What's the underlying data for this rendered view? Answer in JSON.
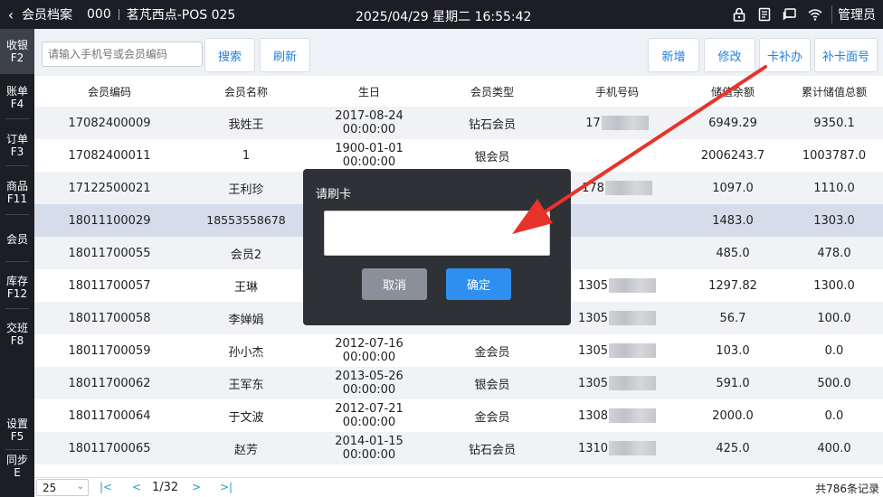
{
  "header": {
    "back_glyph": "‹",
    "title": "会员档案",
    "store_code": "000",
    "store_name": "茗芃西点-POS 025",
    "datetime": "2025/04/29 星期二 16:55:42",
    "user": "管理员",
    "icons": [
      "lock-icon",
      "note-icon",
      "chat-icon",
      "wifi-icon"
    ]
  },
  "sidebar": {
    "items": [
      {
        "label": "收银",
        "key": "F2",
        "active": true
      },
      {
        "label": "账单",
        "key": "F4"
      },
      {
        "label": "订单",
        "key": "F3"
      },
      {
        "label": "商品",
        "key": "F11"
      },
      {
        "label": "会员",
        "key": ""
      },
      {
        "label": "库存",
        "key": "F12"
      },
      {
        "label": "交班",
        "key": "F8"
      },
      {
        "label": "设置",
        "key": "F5"
      },
      {
        "label": "同步",
        "key": "E"
      }
    ]
  },
  "toolbar": {
    "search_placeholder": "请输入手机号或会员编码",
    "search_label": "搜索",
    "refresh_label": "刷新",
    "add_label": "新增",
    "edit_label": "修改",
    "card_issue_label": "卡补办",
    "card_face_label": "补卡面号"
  },
  "table": {
    "columns": [
      "会员编码",
      "会员名称",
      "生日",
      "会员类型",
      "手机号码",
      "储值余额",
      "累计储值总额"
    ],
    "rows": [
      {
        "code": "17082400009",
        "name": "我姓王",
        "birthday": "2017-08-24 00:00:00",
        "type": "钻石会员",
        "phone": "17",
        "balance": "6949.29",
        "total": "9350.1"
      },
      {
        "code": "17082400011",
        "name": "1",
        "birthday": "1900-01-01 00:00:00",
        "type": "银会员",
        "phone": "",
        "balance": "2006243.7",
        "total": "1003787.0"
      },
      {
        "code": "17122500021",
        "name": "王利珍",
        "birthday": "",
        "type": "",
        "phone": "178",
        "balance": "1097.0",
        "total": "1110.0"
      },
      {
        "code": "18011100029",
        "name": "18553558678",
        "birthday": "",
        "type": "",
        "phone": "",
        "balance": "1483.0",
        "total": "1303.0"
      },
      {
        "code": "18011700055",
        "name": "会员2",
        "birthday": "",
        "type": "",
        "phone": "",
        "balance": "485.0",
        "total": "478.0"
      },
      {
        "code": "18011700057",
        "name": "王琳",
        "birthday": "",
        "type": "",
        "phone": "1305",
        "balance": "1297.82",
        "total": "1300.0"
      },
      {
        "code": "18011700058",
        "name": "李婵娟",
        "birthday": "",
        "type": "",
        "phone": "1305",
        "balance": "56.7",
        "total": "100.0"
      },
      {
        "code": "18011700059",
        "name": "孙小杰",
        "birthday": "2012-07-16 00:00:00",
        "type": "金会员",
        "phone": "1305",
        "balance": "103.0",
        "total": "0.0"
      },
      {
        "code": "18011700062",
        "name": "王军东",
        "birthday": "2013-05-26 00:00:00",
        "type": "银会员",
        "phone": "1305",
        "balance": "591.0",
        "total": "500.0"
      },
      {
        "code": "18011700064",
        "name": "于文波",
        "birthday": "2012-07-21 00:00:00",
        "type": "金会员",
        "phone": "1308",
        "balance": "2000.0",
        "total": "0.0"
      },
      {
        "code": "18011700065",
        "name": "赵芳",
        "birthday": "2014-01-15 00:00:00",
        "type": "钻石会员",
        "phone": "1310",
        "balance": "425.0",
        "total": "400.0"
      }
    ]
  },
  "footer": {
    "page_size": "25",
    "page_indicator": "1/32",
    "total_records": "共786条记录"
  },
  "modal": {
    "title": "请刷卡",
    "cancel_label": "取消",
    "ok_label": "确定"
  },
  "colors": {
    "dark_bg": "#1c1e24",
    "accent_blue": "#1f7fe0",
    "annotation_red": "#e8332a",
    "modal_bg": "#2e3136"
  }
}
